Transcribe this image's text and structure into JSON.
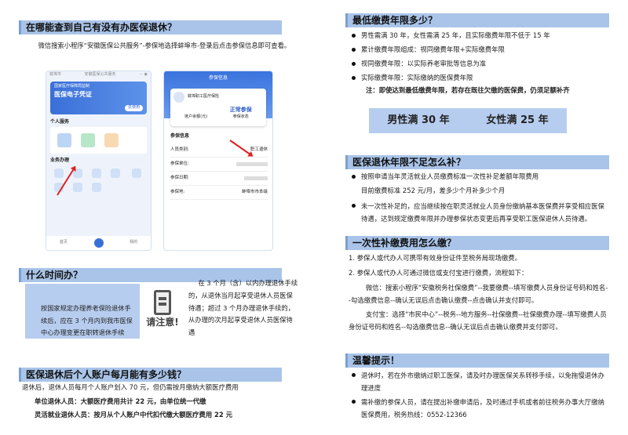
{
  "left": {
    "s1": {
      "title": "在哪能查到自己有没有办医保退休？",
      "para": "微信搜索小程序“安徽医保公共服务”-参保地选择蚌埠市-登录后点击参保信息即可查看。",
      "phone1": {
        "city": "蚌埠市",
        "app": "安徽医保公共服务",
        "card_sub": "国家医疗保障局监制",
        "card_title": "医保电子凭证",
        "card_btn": "去使用",
        "personal": "个人服务",
        "items": [
          "参保信息",
          "缴费",
          "医保码"
        ],
        "business": "业务办理",
        "grid": [
          "参保登记",
          "异地备案",
          "转移接续",
          "慢性病申请",
          "门诊共济",
          "门诊费用",
          "生育报销",
          "个人账户查询",
          "个人缴费记录"
        ],
        "tab_home": "首页",
        "tab_me": "我的"
      },
      "phone2": {
        "title": "参保信息",
        "company": "蚌埠职工医疗保险",
        "status": "正常参保",
        "left_lbl": "账户余额(元)",
        "right_lbl": "参保状态",
        "section": "参保信息",
        "rows": [
          {
            "k": "人员类别:",
            "v": "职工退休"
          },
          {
            "k": "参保单位:",
            "v": ""
          },
          {
            "k": "参保日期:",
            "v": ""
          },
          {
            "k": "参保地:",
            "v": "蚌埠市市本级"
          }
        ]
      }
    },
    "s2": {
      "title": "什么时间办？",
      "box": "按国家规定办理养老保险退休手续后，应在 3 个月内到我市医保中心办理变更在职转退休手续",
      "note_lbl": "请注意!",
      "para": "在 3 个月（含）以内办理退休手续的，从退休当月起享受退休人员医保待遇；超过 3 个月办理退休手续的，从办理的次月起享受退休人员医保待遇"
    },
    "s3": {
      "title": "医保退休后个人账户每月能有多少钱？",
      "line1": "退休后，退休人员每月个人账户划入 70 元，但仍需按月缴纳大额医疗费用",
      "line2": "单位退休人员：大额医疗费用共计 22 元，由单位统一代缴",
      "line3": "灵活就业退休人员：按月从个人账户中代扣代缴大额医疗费用 22 元"
    }
  },
  "right": {
    "s1": {
      "title": "最低缴费年限多少？",
      "bullets": [
        "男性需满 30 年，女性需满 25 年，且实际缴费年限不低于 15 年",
        "累计缴费年限组成：视同缴费年限+实际缴费年限",
        "视同缴费年限：以实际养老审批等信息为准",
        "实际缴费年限：实际缴纳的医保费年限"
      ],
      "note": "注：即使达到最低缴费年限，若存在既往欠缴的医保费，仍须足额补齐",
      "male": "男性满 30 年",
      "female": "女性满 25 年"
    },
    "s2": {
      "title": "医保退休年限不足怎么补？",
      "b1": "按照申请当年灵活就业人员缴费标准一次性补足差额年限费用",
      "b1b": "目前缴费标准 252 元/月，差多少个月补多少个月",
      "b2": "未一次性补足的，应当继续按在职灵活就业人员身份缴纳基本医保费并享受相应医保待遇，达到规定缴费年限并办理参保状态变更后再享受职工医保退休人员待遇。"
    },
    "s3": {
      "title": "一次性补缴费用怎么缴？",
      "i1": "1.  参保人或代办人可携带有效身份证件至税务局现场缴费。",
      "i2": "2.  参保人或代办人可通过微信或支付宝进行缴费，流程如下：",
      "wx": "微信：搜索小程序“安徽税务社保缴费”--我要缴费--填写缴费人员身份证号码和姓名--勾选缴费信息--确认无误后点击确认缴费--点击确认并支付即可。",
      "zfb": "支付宝：选择“市民中心”--税务--地方服务--社保缴费--社保缴费办理--填写缴费人员身份证号码和姓名--勾选缴费信息--确认无误后点击确认缴费并支付即可。"
    },
    "s4": {
      "title": "温馨提示！",
      "b1": "退休时，若在外市缴纳过职工医保，请及时办理医保关系转移手续，以免拖慢退休办理进度",
      "b2": "需补缴的参保人员，请在提出补缴申请后，及时通过手机或者前往税务办事大厅缴纳医保费用，税务热线：0552-12366"
    }
  },
  "colors": {
    "header_bg": "#a9c4e8",
    "box_bg": "#b7cdef",
    "note_red": "#c0392b"
  }
}
